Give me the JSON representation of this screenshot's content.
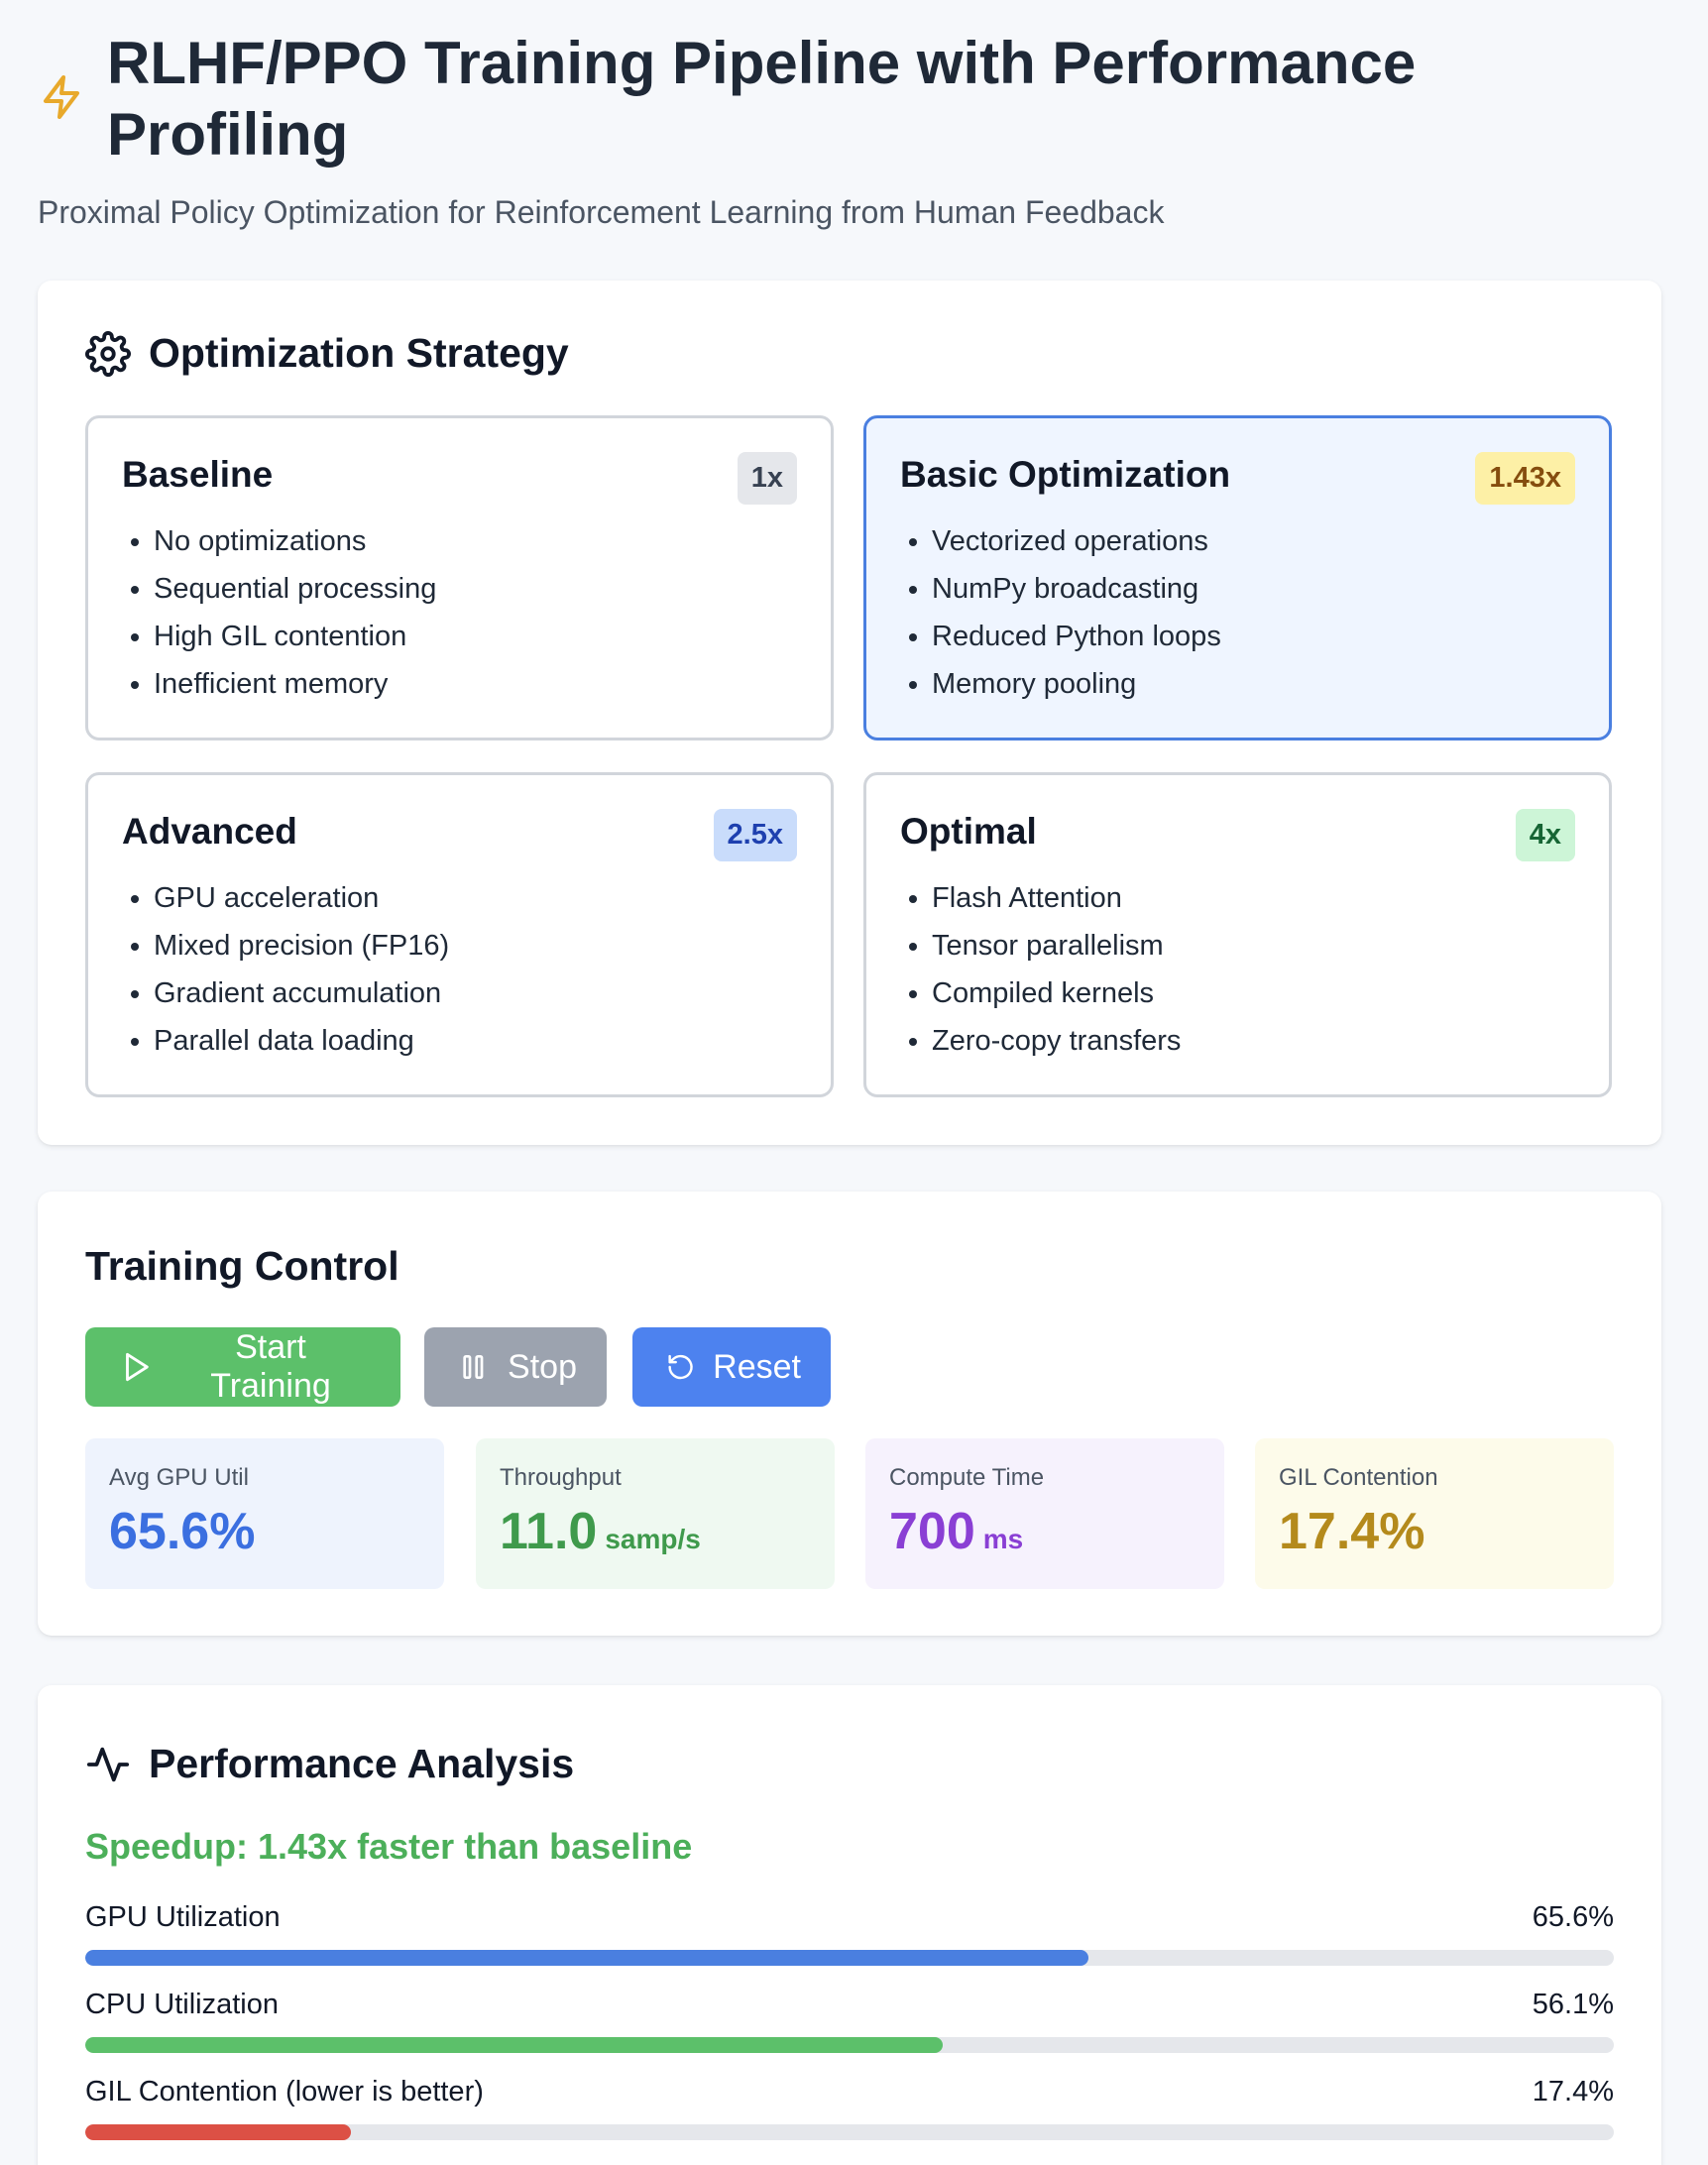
{
  "header": {
    "title": "RLHF/PPO Training Pipeline with Performance Profiling",
    "subtitle": "Proximal Policy Optimization for Reinforcement Learning from Human Feedback",
    "icon": "lightning-icon"
  },
  "strategy": {
    "title": "Optimization Strategy",
    "icon": "gear-icon",
    "options": [
      {
        "name": "Baseline",
        "badge": "1x",
        "items": [
          "No optimizations",
          "Sequential processing",
          "High GIL contention",
          "Inefficient memory"
        ],
        "badge_bg": "#e5e7eb",
        "badge_fg": "#374151",
        "selected": false
      },
      {
        "name": "Basic Optimization",
        "badge": "1.43x",
        "items": [
          "Vectorized operations",
          "NumPy broadcasting",
          "Reduced Python loops",
          "Memory pooling"
        ],
        "badge_bg": "#fdf0a6",
        "badge_fg": "#854d0e",
        "selected": true
      },
      {
        "name": "Advanced",
        "badge": "2.5x",
        "items": [
          "GPU acceleration",
          "Mixed precision (FP16)",
          "Gradient accumulation",
          "Parallel data loading"
        ],
        "badge_bg": "#c9dcfb",
        "badge_fg": "#1e40af",
        "selected": false
      },
      {
        "name": "Optimal",
        "badge": "4x",
        "items": [
          "Flash Attention",
          "Tensor parallelism",
          "Compiled kernels",
          "Zero-copy transfers"
        ],
        "badge_bg": "#cdf5d7",
        "badge_fg": "#166534",
        "selected": false
      }
    ]
  },
  "control": {
    "title": "Training Control",
    "start_label": "Start Training",
    "stop_label": "Stop",
    "reset_label": "Reset",
    "stats": [
      {
        "label": "Avg GPU Util",
        "value": "65.6%",
        "unit": "",
        "bg": "#eef3fd",
        "color": "#3b6fe0"
      },
      {
        "label": "Throughput",
        "value": "11.0",
        "unit": "samp/s",
        "bg": "#eff9f1",
        "color": "#3f9a4c"
      },
      {
        "label": "Compute Time",
        "value": "700",
        "unit": "ms",
        "bg": "#f6f2fd",
        "color": "#8a3fd4"
      },
      {
        "label": "GIL Contention",
        "value": "17.4%",
        "unit": "",
        "bg": "#fdfbea",
        "color": "#b48a1c"
      }
    ]
  },
  "performance": {
    "title": "Performance Analysis",
    "icon": "activity-icon",
    "speedup_text": "Speedup: 1.43x faster than baseline",
    "metrics": [
      {
        "label": "GPU Utilization",
        "value_text": "65.6%",
        "percent": 65.6,
        "color": "#4a7fe0"
      },
      {
        "label": "CPU Utilization",
        "value_text": "56.1%",
        "percent": 56.1,
        "color": "#5cc06a"
      },
      {
        "label": "GIL Contention (lower is better)",
        "value_text": "17.4%",
        "percent": 17.4,
        "color": "#dc5045"
      }
    ]
  }
}
